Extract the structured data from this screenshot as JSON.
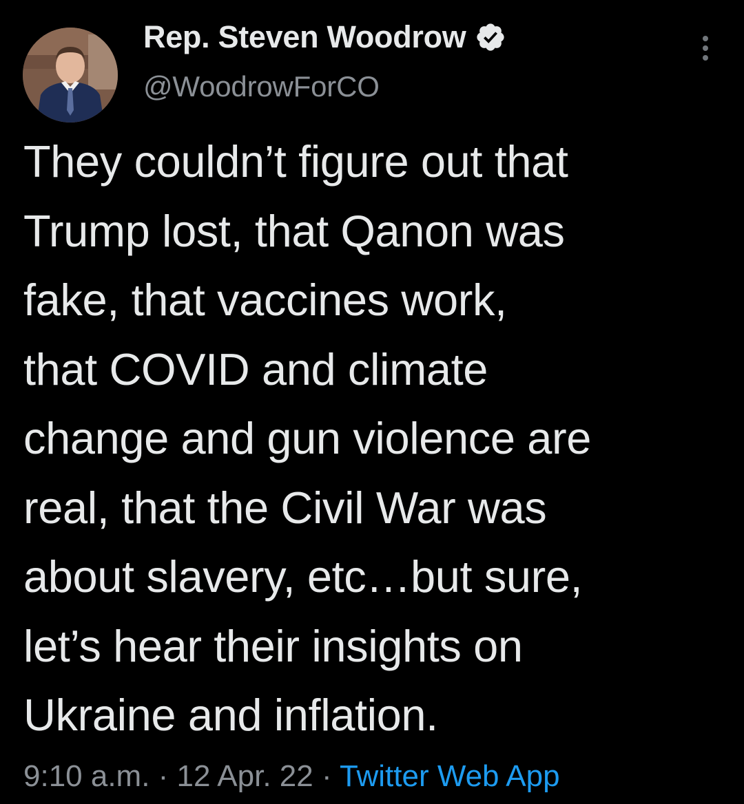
{
  "author": {
    "display_name": "Rep. Steven Woodrow",
    "handle": "@WoodrowForCO",
    "verified": true,
    "avatar_icon": "profile-photo-avatar"
  },
  "more_menu_icon": "vertical-ellipsis-icon",
  "tweet": {
    "lines": [
      "They couldn’t figure out that",
      "Trump lost, that Qanon was",
      "fake, that vaccines work,",
      "that COVID and climate",
      "change and gun violence are",
      "real, that the Civil War was",
      "about slavery, etc…but sure,",
      "let’s hear their insights on",
      "Ukraine and inflation."
    ]
  },
  "meta": {
    "time": "9:10 a.m.",
    "separator": " · ",
    "date": "12 Apr. 22",
    "source": "Twitter Web App"
  },
  "colors": {
    "background": "#000000",
    "text_primary": "#e7e9ea",
    "text_secondary": "#8b9096",
    "link": "#1d9bf0",
    "verified_badge": "#e7e9ea"
  }
}
